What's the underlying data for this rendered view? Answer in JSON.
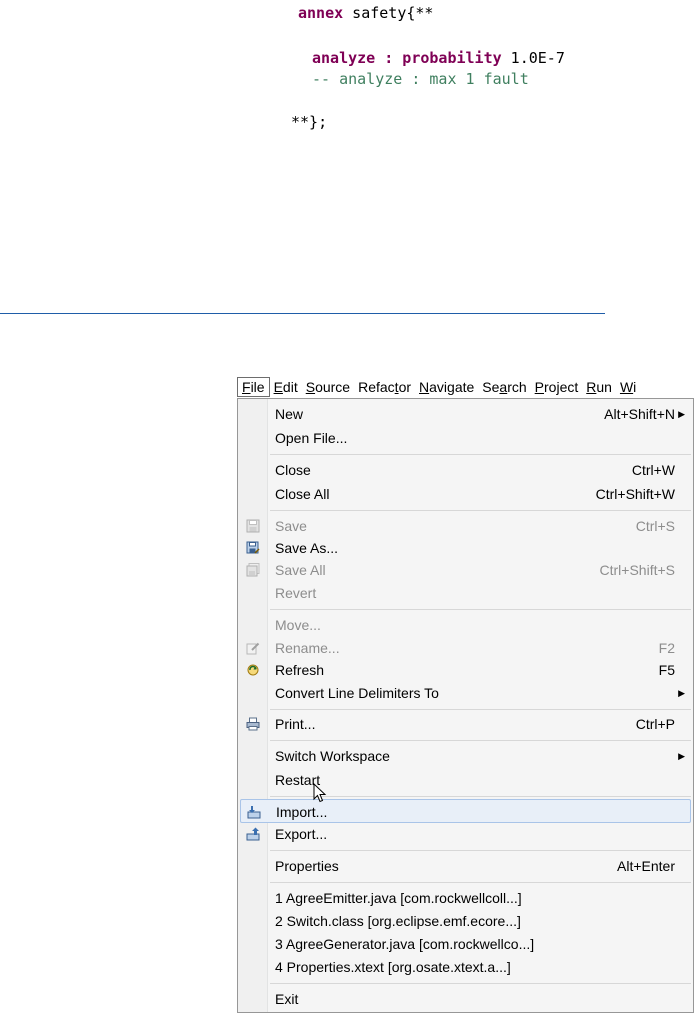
{
  "code": {
    "line1": {
      "keyword": "annex",
      "rest": " safety{**"
    },
    "line2": {
      "keyword": "analyze : probability",
      "rest": " 1.0E-7"
    },
    "line3": "-- analyze : max 1 fault",
    "line4": "**};"
  },
  "menubar": {
    "items": [
      {
        "mnemonic": "F",
        "rest": "ile"
      },
      {
        "mnemonic": "E",
        "rest": "dit"
      },
      {
        "mnemonic": "S",
        "rest": "ource"
      },
      {
        "pre": "Refac",
        "mnemonic": "t",
        "rest": "or"
      },
      {
        "mnemonic": "N",
        "rest": "avigate"
      },
      {
        "pre": "Se",
        "mnemonic": "a",
        "rest": "rch"
      },
      {
        "mnemonic": "P",
        "rest": "roject"
      },
      {
        "mnemonic": "R",
        "rest": "un"
      },
      {
        "mnemonic": "W",
        "rest": "i"
      }
    ]
  },
  "file_menu": {
    "new": {
      "label": "New",
      "accel": "Alt+Shift+N"
    },
    "open_file": {
      "label": "Open File..."
    },
    "close": {
      "label": "Close",
      "accel": "Ctrl+W"
    },
    "close_all": {
      "label": "Close All",
      "accel": "Ctrl+Shift+W"
    },
    "save": {
      "label": "Save",
      "accel": "Ctrl+S"
    },
    "save_as": {
      "label": "Save As..."
    },
    "save_all": {
      "label": "Save All",
      "accel": "Ctrl+Shift+S"
    },
    "revert": {
      "label": "Revert"
    },
    "move": {
      "label": "Move..."
    },
    "rename": {
      "label": "Rename...",
      "accel": "F2"
    },
    "refresh": {
      "label": "Refresh",
      "accel": "F5"
    },
    "convert": {
      "label": "Convert Line Delimiters To"
    },
    "print": {
      "label": "Print...",
      "accel": "Ctrl+P"
    },
    "switch_workspace": {
      "label": "Switch Workspace"
    },
    "restart": {
      "label": "Restart"
    },
    "import": {
      "label": "Import..."
    },
    "export": {
      "label": "Export..."
    },
    "properties": {
      "label": "Properties",
      "accel": "Alt+Enter"
    },
    "recent": [
      "1 AgreeEmitter.java  [com.rockwellcoll...]",
      "2 Switch.class  [org.eclipse.emf.ecore...]",
      "3 AgreeGenerator.java  [com.rockwellco...]",
      "4 Properties.xtext  [org.osate.xtext.a...]"
    ],
    "exit": {
      "label": "Exit"
    }
  },
  "colors": {
    "keyword": "#7f0055",
    "comment": "#3f7f5f",
    "divider": "#1f5da8",
    "hover_bg": "#e8eff8"
  }
}
